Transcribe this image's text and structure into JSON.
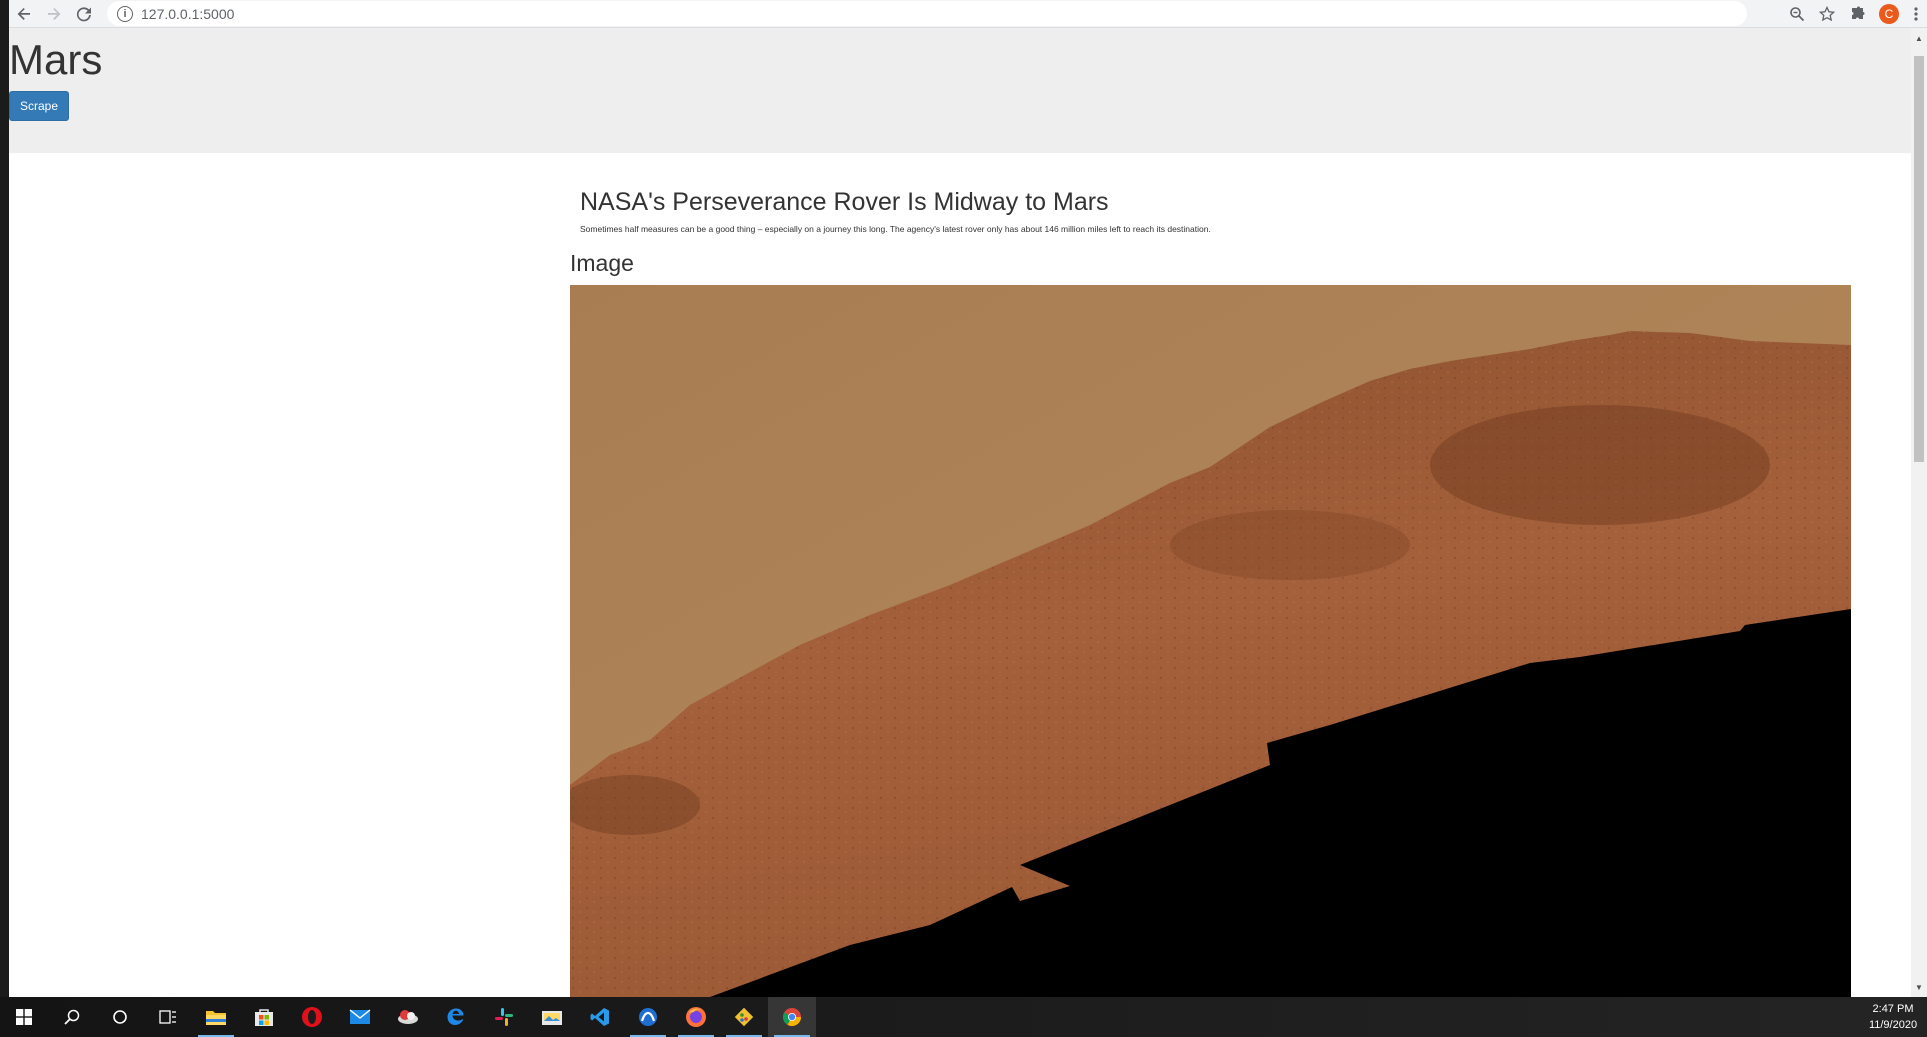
{
  "browser": {
    "url": "127.0.0.1:5000",
    "profile_initial": "C"
  },
  "page": {
    "site_title": "Mars",
    "scrape_label": "Scrape",
    "news_title": "NASA's Perseverance Rover Is Midway to Mars",
    "news_teaser": "Sometimes half measures can be a good thing – especially on a journey this long. The agency's latest rover only has about 146 million miles left to reach its destination.",
    "image_heading": "Image"
  },
  "taskbar": {
    "time": "2:47 PM",
    "date": "11/9/2020",
    "apps": [
      "start-icon",
      "search-icon",
      "cortana-icon",
      "task-view-icon",
      "file-explorer-icon",
      "store-icon",
      "opera-icon",
      "mail-icon",
      "weather-app-icon",
      "edge-icon",
      "slack-icon",
      "photos-icon",
      "vscode-icon",
      "app-icon",
      "firefox-icon",
      "git-icon",
      "chrome-icon"
    ]
  },
  "colors": {
    "jumbotron": "#eeeeee",
    "button": "#337ab7",
    "sky": "#a88053",
    "terrain": "#9b5a35"
  }
}
